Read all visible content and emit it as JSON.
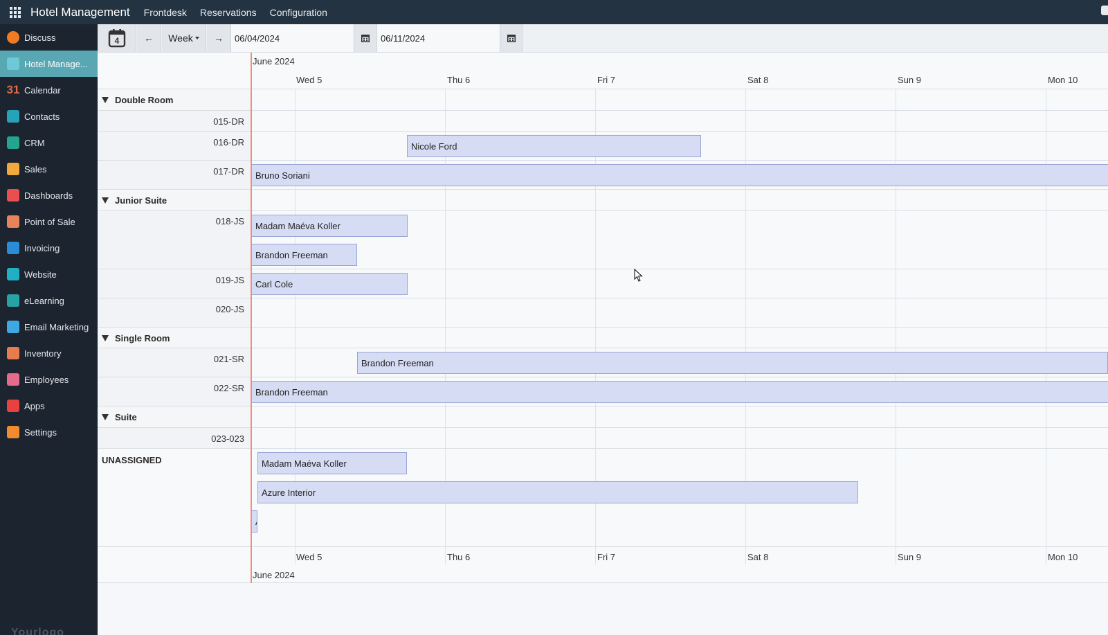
{
  "navbar": {
    "brand": "Hotel Management",
    "menus": [
      "Frontdesk",
      "Reservations",
      "Configuration"
    ]
  },
  "sidebar": {
    "items": [
      {
        "label": "Discuss",
        "icon": "discuss-icon",
        "color": "#f07b22"
      },
      {
        "label": "Hotel Manage...",
        "icon": "hotel-icon",
        "color": "#6ccad6",
        "active": true
      },
      {
        "label": "Calendar",
        "icon": "calendar-31-icon",
        "color": "#e06b4a"
      },
      {
        "label": "Contacts",
        "icon": "contacts-icon",
        "color": "#27a3b8"
      },
      {
        "label": "CRM",
        "icon": "crm-icon",
        "color": "#23a58e"
      },
      {
        "label": "Sales",
        "icon": "sales-icon",
        "color": "#f0a93b"
      },
      {
        "label": "Dashboards",
        "icon": "dashboards-icon",
        "color": "#e94f4f"
      },
      {
        "label": "Point of Sale",
        "icon": "pos-icon",
        "color": "#e8845a"
      },
      {
        "label": "Invoicing",
        "icon": "invoicing-icon",
        "color": "#2b8bd6"
      },
      {
        "label": "Website",
        "icon": "website-icon",
        "color": "#20b0c4"
      },
      {
        "label": "eLearning",
        "icon": "elearning-icon",
        "color": "#27a3a8"
      },
      {
        "label": "Email Marketing",
        "icon": "email-marketing-icon",
        "color": "#3fa8e0"
      },
      {
        "label": "Inventory",
        "icon": "inventory-icon",
        "color": "#e87c4f"
      },
      {
        "label": "Employees",
        "icon": "employees-icon",
        "color": "#e46b8a"
      },
      {
        "label": "Apps",
        "icon": "apps-icon",
        "color": "#e8413f"
      },
      {
        "label": "Settings",
        "icon": "settings-icon",
        "color": "#f08c2f"
      }
    ],
    "watermark": "Yourlogo"
  },
  "toolbar": {
    "scale_label": "Week",
    "start_date": "06/04/2024",
    "end_date": "06/11/2024",
    "today_day": "4"
  },
  "gantt": {
    "month": "June 2024",
    "days": [
      "Wed 5",
      "Thu 6",
      "Fri 7",
      "Sat 8",
      "Sun 9",
      "Mon 10"
    ],
    "groups": [
      "Double Room",
      "Junior Suite",
      "Single Room",
      "Suite"
    ],
    "rooms": [
      "015-DR",
      "016-DR",
      "017-DR",
      "018-JS",
      "019-JS",
      "020-JS",
      "021-SR",
      "022-SR",
      "023-023"
    ],
    "unassigned_label": "UNASSIGNED",
    "reservations": [
      {
        "guest": "Nicole Ford",
        "room": "016-DR"
      },
      {
        "guest": "Bruno Soriani",
        "room": "017-DR"
      },
      {
        "guest": "Madam Maéva Koller",
        "room": "018-JS"
      },
      {
        "guest": "Brandon Freeman",
        "room": "018-JS"
      },
      {
        "guest": "Carl Cole",
        "room": "019-JS"
      },
      {
        "guest": "Brandon Freeman",
        "room": "021-SR"
      },
      {
        "guest": "Brandon Freeman",
        "room": "022-SR"
      },
      {
        "guest": "Madam Maéva Koller",
        "room": "UNASSIGNED"
      },
      {
        "guest": "Azure Interior",
        "room": "UNASSIGNED"
      },
      {
        "guest": "A",
        "room": "UNASSIGNED"
      }
    ]
  }
}
